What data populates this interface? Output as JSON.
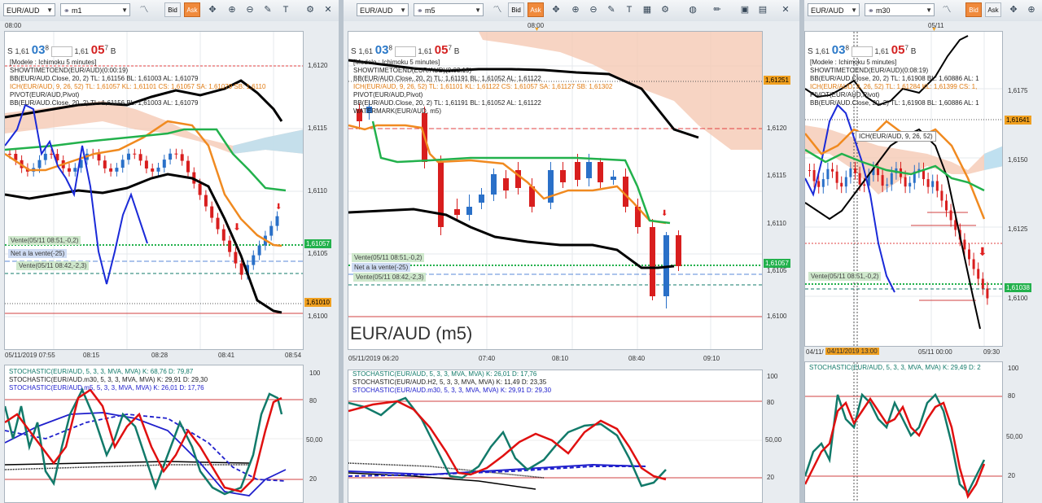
{
  "panels": [
    {
      "symbol": "EUR/AUD",
      "timeframe": "m1",
      "bid": "Bid",
      "ask": "Ask",
      "top_time": "08:00",
      "quote": {
        "s": "S",
        "s_small": "1,61",
        "s_big": "03",
        "s_sup": "8",
        "b_small": "1,61",
        "b_big": "05",
        "b_sup": "7",
        "b": "B"
      },
      "lines": [
        {
          "text": "[Modele : Ichimoku 5 minutes]",
          "color": "#222"
        },
        {
          "text": "SHOWTIMETOEND(EUR/AUD)(0:00:19)",
          "color": "#222"
        },
        {
          "text": "BB(EUR/AUD.Close, 20, 2)  TL: 1,61156  BL: 1,61003  AL: 1,61079",
          "color": "#222"
        },
        {
          "text": "ICH(EUR/AUD, 9, 26, 52)  TL: 1,61057  KL: 1,61101  CS: 1,61057  SA: 1,61079  SB: 1,6110",
          "color": "#e07a10"
        },
        {
          "text": "PIVOT(EUR/AUD,Pivot)",
          "color": "#222"
        },
        {
          "text": "BB(EUR/AUD.Close, 20, 2)  TL: 1,61156  BL: 1,61003  AL: 1,61079",
          "color": "#222"
        }
      ],
      "yticks": [
        "1,6120",
        "1,6115",
        "1,6110",
        "1,6105",
        "1,6100"
      ],
      "price_tags": [
        {
          "text": "1,61057",
          "bg": "#22b14c",
          "color": "#fff"
        },
        {
          "text": "1,61010",
          "bg": "#f0a020",
          "color": "#000"
        }
      ],
      "tags": [
        {
          "text": "Vente(05/11 08:51,-0,2)"
        },
        {
          "text": "Net a la vente(-25)"
        },
        {
          "text": "Vente(05/11 08:42,-2,3)"
        }
      ],
      "xticks": [
        "05/11/2019 07:55",
        "08:15",
        "08:28",
        "08:41",
        "08:54"
      ],
      "stoch_lines": [
        {
          "text": "STOCHASTIC(EUR/AUD, 5, 3, 3, MVA, MVA)  K: 68,76  D: 79,87",
          "color": "#127a6a"
        },
        {
          "text": "STOCHASTIC(EUR/AUD.m30, 5, 3, 3, MVA, MVA)  K: 29,91  D: 29,30",
          "color": "#222"
        },
        {
          "text": "STOCHASTIC(EUR/AUD.m5, 5, 3, 3, MVA, MVA)  K: 26,01  D: 17,76",
          "color": "#2020cc"
        }
      ],
      "stoch_yticks": [
        "100",
        "80",
        "50,00",
        "20"
      ]
    },
    {
      "symbol": "EUR/AUD",
      "timeframe": "m5",
      "bid": "Bid",
      "ask": "Ask",
      "top_time": "08:00",
      "quote": {
        "s": "S",
        "s_small": "1,61",
        "s_big": "03",
        "s_sup": "8",
        "b_small": "1,61",
        "b_big": "05",
        "b_sup": "7",
        "b": "B"
      },
      "lines": [
        {
          "text": "[Modele : Ichimoku 5 minutes]",
          "color": "#222"
        },
        {
          "text": "SHOWTIMETOEND(EUR/AUD)(0:03:19)",
          "color": "#222"
        },
        {
          "text": "BB(EUR/AUD.Close, 20, 2)  TL: 1,61191  BL: 1,61052  AL: 1,61122",
          "color": "#222"
        },
        {
          "text": "ICH(EUR/AUD, 9, 26, 52)  TL: 1,61101  KL: 1,61122  CS: 1,61057  SA: 1,61127  SB: 1,61302",
          "color": "#e07a10"
        },
        {
          "text": "PIVOT(EUR/AUD,Pivot)",
          "color": "#222"
        },
        {
          "text": "BB(EUR/AUD.Close, 20, 2)  TL: 1,61191  BL: 1,61052  AL: 1,61122",
          "color": "#222"
        },
        {
          "text": "WATERMARK(EUR/AUD, m5)",
          "color": "#222"
        }
      ],
      "watermark": "EUR/AUD (m5)",
      "yticks": [
        "1,6120",
        "1,6115",
        "1,6110",
        "1,6105",
        "1,6100"
      ],
      "price_tags": [
        {
          "text": "1,61251",
          "bg": "#f0a020",
          "color": "#000"
        },
        {
          "text": "1,61057",
          "bg": "#22b14c",
          "color": "#fff"
        }
      ],
      "tags": [
        {
          "text": "Vente(05/11 08:51,-0,2)"
        },
        {
          "text": "Net a la vente(-25)"
        },
        {
          "text": "Vente(05/11 08:42,-2,3)"
        }
      ],
      "xticks": [
        "05/11/2019 06:20",
        "07:40",
        "08:10",
        "08:40",
        "09:10"
      ],
      "stoch_lines": [
        {
          "text": "STOCHASTIC(EUR/AUD, 5, 3, 3, MVA, MVA)  K: 26,01  D: 17,76",
          "color": "#127a6a"
        },
        {
          "text": "STOCHASTIC(EUR/AUD.H2, 5, 3, 3, MVA, MVA)  K: 11,49  D: 23,35",
          "color": "#222"
        },
        {
          "text": "STOCHASTIC(EUR/AUD.m30, 5, 3, 3, MVA, MVA)  K: 29,91  D: 29,30",
          "color": "#2020cc"
        }
      ],
      "stoch_yticks": [
        "100",
        "80",
        "50,00",
        "20"
      ]
    },
    {
      "symbol": "EUR/AUD",
      "timeframe": "m30",
      "bid": "Bid",
      "ask": "Ask",
      "top_time": "05/11",
      "quote": {
        "s": "S",
        "s_small": "1,61",
        "s_big": "03",
        "s_sup": "8",
        "b_small": "1,61",
        "b_big": "05",
        "b_sup": "7",
        "b": "B"
      },
      "lines": [
        {
          "text": "[Modele : Ichimoku 5 minutes]",
          "color": "#222"
        },
        {
          "text": "SHOWTIMETOEND(EUR/AUD)(0:08:19)",
          "color": "#222"
        },
        {
          "text": "BB(EUR/AUD.Close, 20, 2)  TL: 1,61908  BL: 1,60886  AL: 1",
          "color": "#222"
        },
        {
          "text": "ICH(EUR/AUD, 9, 26, 52)  TL: 1,61284  KL: 1,61399  CS: 1,",
          "color": "#e07a10"
        },
        {
          "text": "PIVOT(EUR/AUD,Pivot)",
          "color": "#222"
        },
        {
          "text": "BB(EUR/AUD.Close, 20, 2)  TL: 1,61908  BL: 1,60886  AL: 1",
          "color": "#222"
        }
      ],
      "tooltip": "ICH(EUR/AUD, 9, 26, 52)",
      "yticks": [
        "1,6175",
        "1,6150",
        "1,6125",
        "1,6100"
      ],
      "price_tags": [
        {
          "text": "1,61641",
          "bg": "#f0a020",
          "color": "#000"
        },
        {
          "text": "1,61038",
          "bg": "#22b14c",
          "color": "#fff"
        }
      ],
      "tags": [
        {
          "text": "Vente(05/11 08:51,-0,2)"
        }
      ],
      "xticks": [
        "04/11/",
        "04/11/2019 13:00",
        "05/11 00:00",
        "09:30"
      ],
      "stoch_lines": [
        {
          "text": "STOCHASTIC(EUR/AUD, 5, 3, 3, MVA, MVA)  K: 29,49  D: 2",
          "color": "#127a6a"
        }
      ],
      "stoch_yticks": [
        "100",
        "80",
        "50,00",
        "20"
      ]
    }
  ],
  "icons": {
    "chart_type": "line-chart-icon",
    "cursor": "crosshair-icon",
    "zoom_in": "zoom-in-icon",
    "zoom_out": "zoom-out-icon",
    "settings": "gear-icon"
  },
  "colors": {
    "up": "#2a70c8",
    "down": "#d81e1e",
    "ichimoku_fast": "#f08a20",
    "ichimoku_slow": "#22b14c",
    "bb": "#000000",
    "cloud": "#f5c9b4",
    "stoch_k": "#127a6a",
    "stoch_d": "#e01010"
  }
}
